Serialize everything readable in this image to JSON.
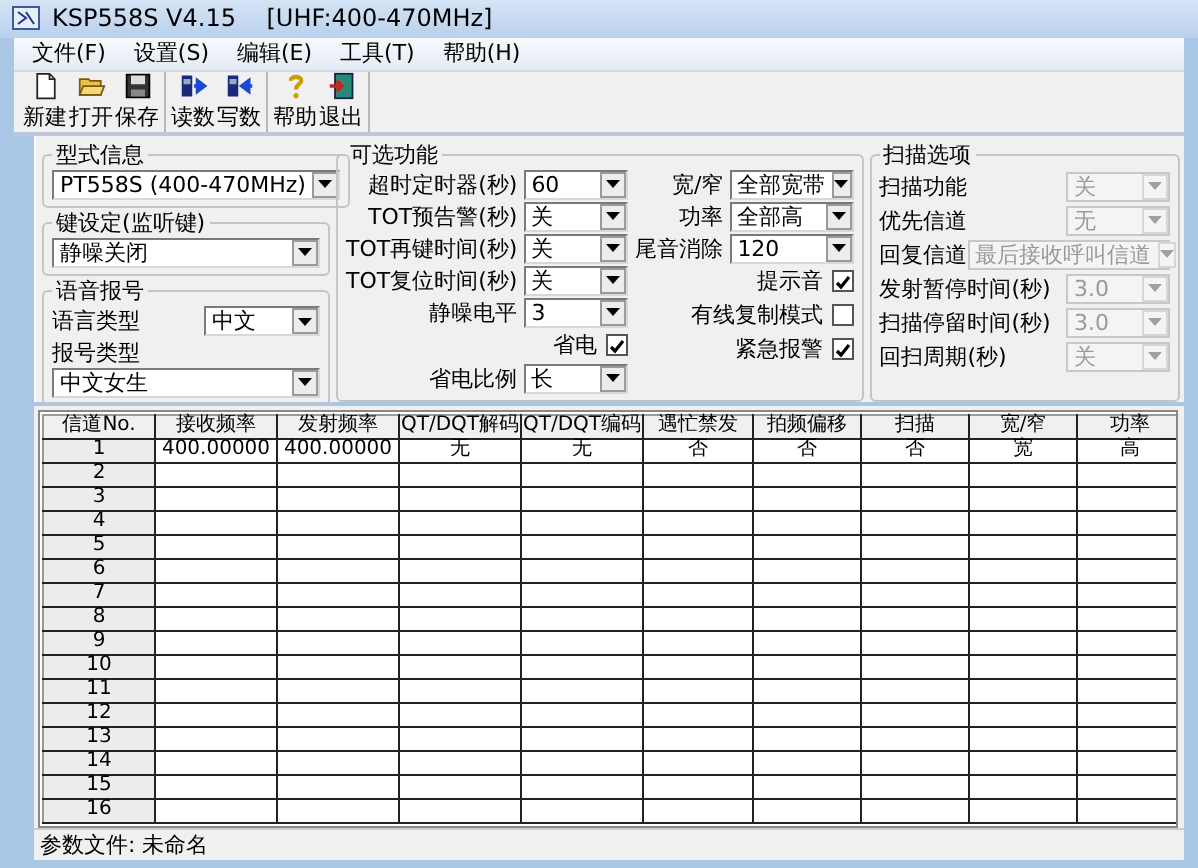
{
  "window": {
    "title": "KSP558S V4.15    [UHF:400-470MHz]"
  },
  "menu": [
    {
      "label": "文件(F)"
    },
    {
      "label": "设置(S)"
    },
    {
      "label": "编辑(E)"
    },
    {
      "label": "工具(T)"
    },
    {
      "label": "帮助(H)"
    }
  ],
  "toolbar": [
    [
      {
        "label": "新建",
        "kind": "new"
      },
      {
        "label": "打开",
        "kind": "open"
      },
      {
        "label": "保存",
        "kind": "save"
      }
    ],
    [
      {
        "label": "读数",
        "kind": "read"
      },
      {
        "label": "写数",
        "kind": "write"
      }
    ],
    [
      {
        "label": "帮助",
        "kind": "help"
      },
      {
        "label": "退出",
        "kind": "exit"
      }
    ]
  ],
  "model": {
    "title": "型式信息",
    "value": "PT558S (400-470MHz)"
  },
  "key_setting": {
    "title": "键设定(监听键)",
    "value": "静噪关闭"
  },
  "voice": {
    "title": "语音报号",
    "fields": [
      {
        "label": "语言类型",
        "value": "中文",
        "kind": "inline"
      },
      {
        "label": "报号类型",
        "value": "中文女生",
        "kind": "stacked"
      }
    ]
  },
  "optional": {
    "title": "可选功能",
    "left": [
      {
        "kind": "select",
        "label": "超时定时器(秒)",
        "value": "60"
      },
      {
        "kind": "select",
        "label": "TOT预告警(秒)",
        "value": "关"
      },
      {
        "kind": "select",
        "label": "TOT再键时间(秒)",
        "value": "关"
      },
      {
        "kind": "select",
        "label": "TOT复位时间(秒)",
        "value": "关"
      },
      {
        "kind": "select",
        "label": "静噪电平",
        "value": "3"
      },
      {
        "kind": "checkbox",
        "label": "省电",
        "checked": true
      },
      {
        "kind": "select",
        "label": "省电比例",
        "value": "长"
      }
    ],
    "right": [
      {
        "kind": "select",
        "label": "宽/窄",
        "value": "全部宽带"
      },
      {
        "kind": "select",
        "label": "功率",
        "value": "全部高"
      },
      {
        "kind": "select",
        "label": "尾音消除",
        "value": "120"
      },
      {
        "kind": "checkbox",
        "label": "提示音",
        "checked": true
      },
      {
        "kind": "checkbox",
        "label": "有线复制模式",
        "checked": false
      },
      {
        "kind": "checkbox",
        "label": "紧急报警",
        "checked": true
      }
    ]
  },
  "scan": {
    "title": "扫描选项",
    "fields": [
      {
        "label": "扫描功能",
        "value": "关",
        "disabled": true
      },
      {
        "label": "优先信道",
        "value": "无",
        "disabled": true
      },
      {
        "label": "回复信道",
        "value": "最后接收呼叫信道",
        "disabled": true
      },
      {
        "label": "发射暂停时间(秒)",
        "value": "3.0",
        "disabled": true
      },
      {
        "label": "扫描停留时间(秒)",
        "value": "3.0",
        "disabled": true
      },
      {
        "label": "回扫周期(秒)",
        "value": "关",
        "disabled": true
      }
    ]
  },
  "table": {
    "columns": [
      "信道No.",
      "接收频率",
      "发射频率",
      "QT/DQT解码",
      "QT/DQT编码",
      "遇忙禁发",
      "拍频偏移",
      "扫描",
      "宽/窄",
      "功率"
    ],
    "rows": [
      {
        "number": "1",
        "cells": [
          "400.00000",
          "400.00000",
          "无",
          "无",
          "否",
          "否",
          "否",
          "宽",
          "高"
        ]
      },
      {
        "number": "2"
      },
      {
        "number": "3"
      },
      {
        "number": "4"
      },
      {
        "number": "5"
      },
      {
        "number": "6"
      },
      {
        "number": "7"
      },
      {
        "number": "8"
      },
      {
        "number": "9"
      },
      {
        "number": "10"
      },
      {
        "number": "11"
      },
      {
        "number": "12"
      },
      {
        "number": "13"
      },
      {
        "number": "14"
      },
      {
        "number": "15"
      },
      {
        "number": "16"
      }
    ]
  },
  "status_bar": {
    "text": "参数文件: 未命名"
  }
}
